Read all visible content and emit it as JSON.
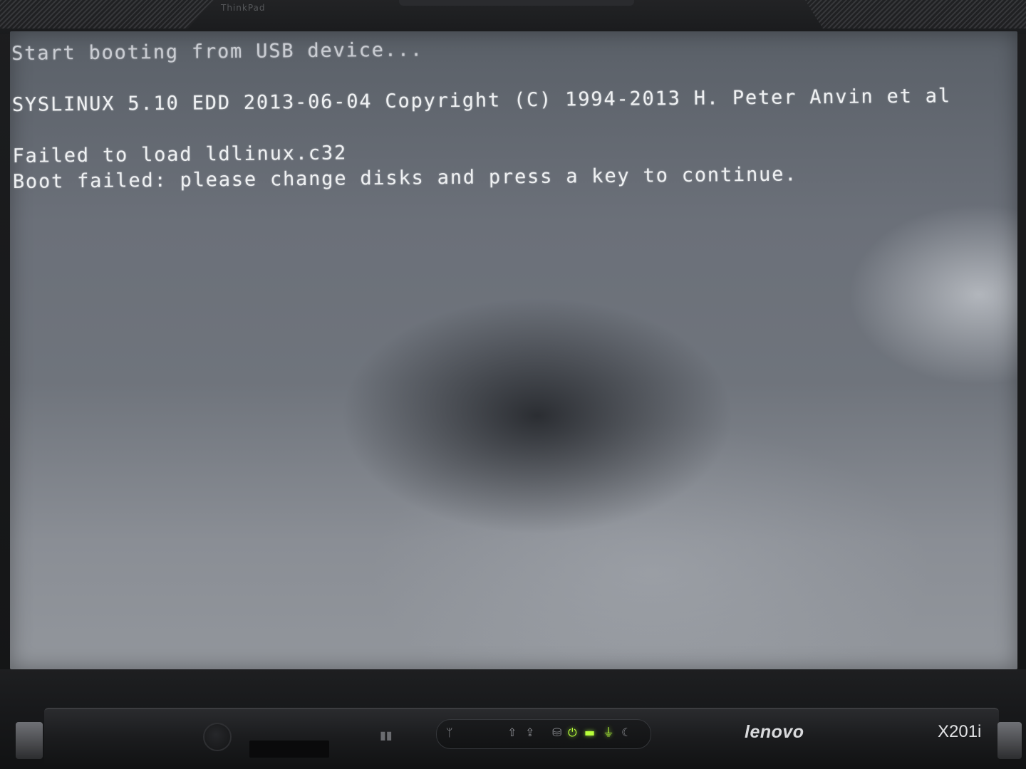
{
  "bezel": {
    "top_label": "ThinkPad"
  },
  "terminal": {
    "lines": [
      "Start booting from USB device...",
      "",
      "SYSLINUX 5.10 EDD 2013-06-04 Copyright (C) 1994-2013 H. Peter Anvin et al",
      "",
      "Failed to load ldlinux.c32",
      "Boot failed: please change disks and press a key to continue."
    ]
  },
  "laptop": {
    "brand": "lenovo",
    "model": "X201i"
  },
  "indicators": {
    "power_color": "#b9ff3a",
    "icons": [
      "wireless-icon",
      "caps-lock-icon",
      "num-lock-icon",
      "disk-access-icon",
      "power-on-icon",
      "battery-icon",
      "ac-power-icon",
      "sleep-icon"
    ]
  }
}
